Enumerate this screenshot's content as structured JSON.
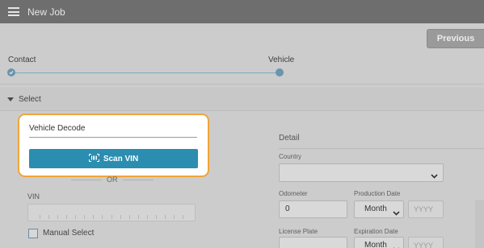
{
  "header": {
    "title": "New Job"
  },
  "nav": {
    "previous_label": "Previous"
  },
  "stepper": {
    "steps": [
      {
        "label": "Contact",
        "state": "complete"
      },
      {
        "label": "Vehicle",
        "state": "current"
      }
    ]
  },
  "section": {
    "label": "Select"
  },
  "vehicle_decode": {
    "field_label": "Vehicle Decode",
    "scan_button_label": "Scan VIN",
    "or_text": "OR",
    "vin_label": "VIN",
    "vin_value": "",
    "manual_select_label": "Manual Select",
    "manual_select_checked": false
  },
  "detail": {
    "title": "Detail",
    "country_label": "Country",
    "country_value": "",
    "odometer_label": "Odometer",
    "odometer_value": "0",
    "production_date_label": "Production Date",
    "production_month": "Month",
    "production_year_placeholder": "YYYY",
    "license_plate_label": "License Plate",
    "license_plate_value": "",
    "expiration_date_label": "Expiration Date",
    "expiration_month": "Month",
    "expiration_year_placeholder": "YYYY"
  },
  "colors": {
    "accent": "#2b8db0",
    "highlight_border": "#f0a53a",
    "stepper": "#6b94ad"
  }
}
